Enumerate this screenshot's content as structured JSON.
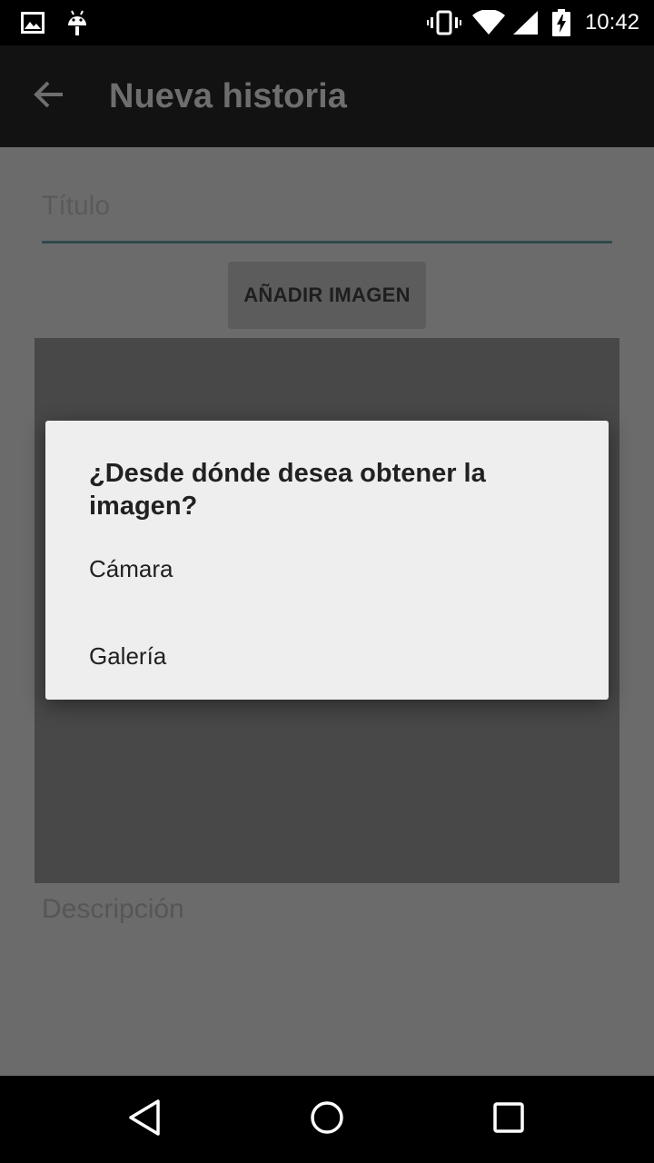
{
  "status_bar": {
    "time": "10:42",
    "icons": [
      "image-notification-icon",
      "android-notification-icon",
      "vibrate-icon",
      "wifi-icon",
      "cell-signal-icon",
      "battery-charging-icon"
    ]
  },
  "app_bar": {
    "title": "Nueva historia",
    "back_icon": "arrow-back-icon"
  },
  "form": {
    "title_placeholder": "Título",
    "add_image_label": "AÑADIR IMAGEN",
    "description_placeholder": "Descripción"
  },
  "dialog": {
    "title": "¿Desde dónde desea obtener la imagen?",
    "options": [
      "Cámara",
      "Galería"
    ]
  },
  "nav_bar": {
    "icons": [
      "back-triangle-icon",
      "home-circle-icon",
      "recents-square-icon"
    ]
  },
  "colors": {
    "scrim_background": "#6b6b6b",
    "app_bar": "#121212",
    "dialog_background": "#eeeeee",
    "accent_underline": "#2f4a4a"
  }
}
